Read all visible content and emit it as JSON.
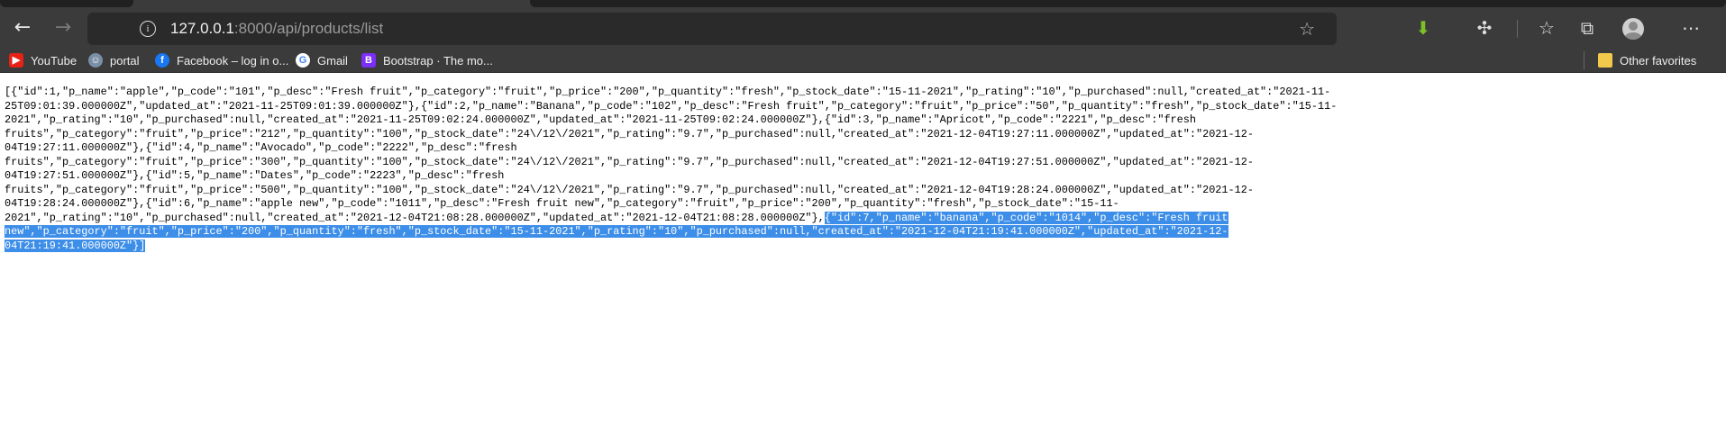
{
  "browser": {
    "address": {
      "host": "127.0.0.1",
      "rest": ":8000/api/products/list"
    },
    "bookmarks": [
      {
        "label": "YouTube",
        "icon": "youtube-icon",
        "color": "#e62117"
      },
      {
        "label": "portal",
        "icon": "portal-icon",
        "color": "#7a8fa6"
      },
      {
        "label": "Facebook – log in o...",
        "icon": "facebook-icon",
        "color": "#1877f2"
      },
      {
        "label": "Gmail",
        "icon": "google-icon",
        "color": "#ffffff"
      },
      {
        "label": "Bootstrap · The mo...",
        "icon": "bootstrap-icon",
        "color": "#7b2ff7"
      }
    ],
    "other_favorites": "Other favorites"
  },
  "page": {
    "selection_color": "#3d8ee8",
    "lines": [
      {
        "text": "[{\"id\":1,\"p_name\":\"apple\",\"p_code\":\"101\",\"p_desc\":\"Fresh fruit\",\"p_category\":\"fruit\",\"p_price\":\"200\",\"p_quantity\":\"fresh\",\"p_stock_date\":\"15-11-2021\",\"p_rating\":\"10\",\"p_purchased\":null,\"created_at\":\"2021-11-"
      },
      {
        "text": "25T09:01:39.000000Z\",\"updated_at\":\"2021-11-25T09:01:39.000000Z\"},{\"id\":2,\"p_name\":\"Banana\",\"p_code\":\"102\",\"p_desc\":\"Fresh fruit\",\"p_category\":\"fruit\",\"p_price\":\"50\",\"p_quantity\":\"fresh\",\"p_stock_date\":\"15-11-"
      },
      {
        "text": "2021\",\"p_rating\":\"10\",\"p_purchased\":null,\"created_at\":\"2021-11-25T09:02:24.000000Z\",\"updated_at\":\"2021-11-25T09:02:24.000000Z\"},{\"id\":3,\"p_name\":\"Apricot\",\"p_code\":\"2221\",\"p_desc\":\"fresh"
      },
      {
        "text": "fruits\",\"p_category\":\"fruit\",\"p_price\":\"212\",\"p_quantity\":\"100\",\"p_stock_date\":\"24\\/12\\/2021\",\"p_rating\":\"9.7\",\"p_purchased\":null,\"created_at\":\"2021-12-04T19:27:11.000000Z\",\"updated_at\":\"2021-12-"
      },
      {
        "text": "04T19:27:11.000000Z\"},{\"id\":4,\"p_name\":\"Avocado\",\"p_code\":\"2222\",\"p_desc\":\"fresh"
      },
      {
        "text": "fruits\",\"p_category\":\"fruit\",\"p_price\":\"300\",\"p_quantity\":\"100\",\"p_stock_date\":\"24\\/12\\/2021\",\"p_rating\":\"9.7\",\"p_purchased\":null,\"created_at\":\"2021-12-04T19:27:51.000000Z\",\"updated_at\":\"2021-12-"
      },
      {
        "text": "04T19:27:51.000000Z\"},{\"id\":5,\"p_name\":\"Dates\",\"p_code\":\"2223\",\"p_desc\":\"fresh"
      },
      {
        "text": "fruits\",\"p_category\":\"fruit\",\"p_price\":\"500\",\"p_quantity\":\"100\",\"p_stock_date\":\"24\\/12\\/2021\",\"p_rating\":\"9.7\",\"p_purchased\":null,\"created_at\":\"2021-12-04T19:28:24.000000Z\",\"updated_at\":\"2021-12-"
      },
      {
        "text": "04T19:28:24.000000Z\"},{\"id\":6,\"p_name\":\"apple new\",\"p_code\":\"1011\",\"p_desc\":\"Fresh fruit new\",\"p_category\":\"fruit\",\"p_price\":\"200\",\"p_quantity\":\"fresh\",\"p_stock_date\":\"15-11-"
      },
      {
        "text": "2021\",\"p_rating\":\"10\",\"p_purchased\":null,\"created_at\":\"2021-12-04T21:08:28.000000Z\",\"updated_at\":\"2021-12-04T21:08:28.000000Z\"},",
        "selected": "{\"id\":7,\"p_name\":\"banana\",\"p_code\":\"1014\",\"p_desc\":\"Fresh fruit"
      },
      {
        "text": "",
        "selected": "new\",\"p_category\":\"fruit\",\"p_price\":\"200\",\"p_quantity\":\"fresh\",\"p_stock_date\":\"15-11-2021\",\"p_rating\":\"10\",\"p_purchased\":null,\"created_at\":\"2021-12-04T21:19:41.000000Z\",\"updated_at\":\"2021-12-"
      },
      {
        "text": "",
        "selected": "04T21:19:41.000000Z\"}]"
      }
    ]
  }
}
